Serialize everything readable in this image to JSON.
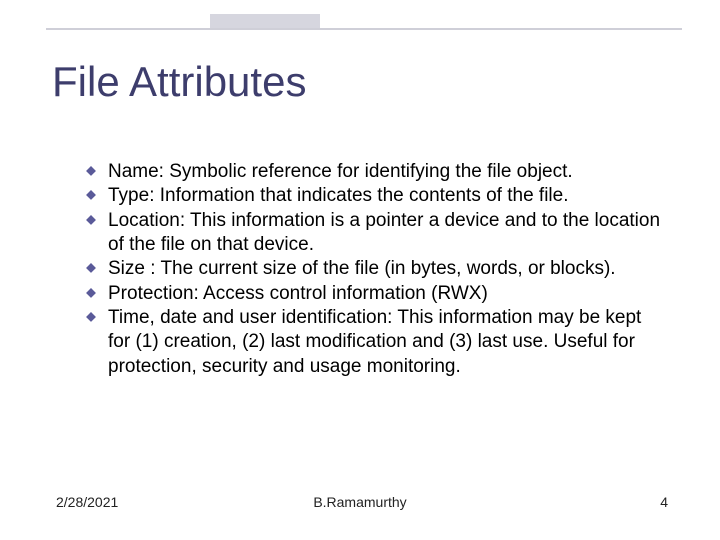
{
  "slide": {
    "title": "File Attributes",
    "bullets": [
      "Name: Symbolic reference for identifying the file object.",
      "Type: Information that indicates the contents of the file.",
      "Location: This information is a pointer a device and to the location of the file on that device.",
      "Size : The current size of the file (in bytes, words, or blocks).",
      "Protection:  Access control information (RWX)",
      "Time, date and user identification: This information may be kept for (1) creation, (2) last modification and (3) last use. Useful for protection, security and usage monitoring."
    ]
  },
  "footer": {
    "date": "2/28/2021",
    "author": "B.Ramamurthy",
    "page": "4"
  }
}
